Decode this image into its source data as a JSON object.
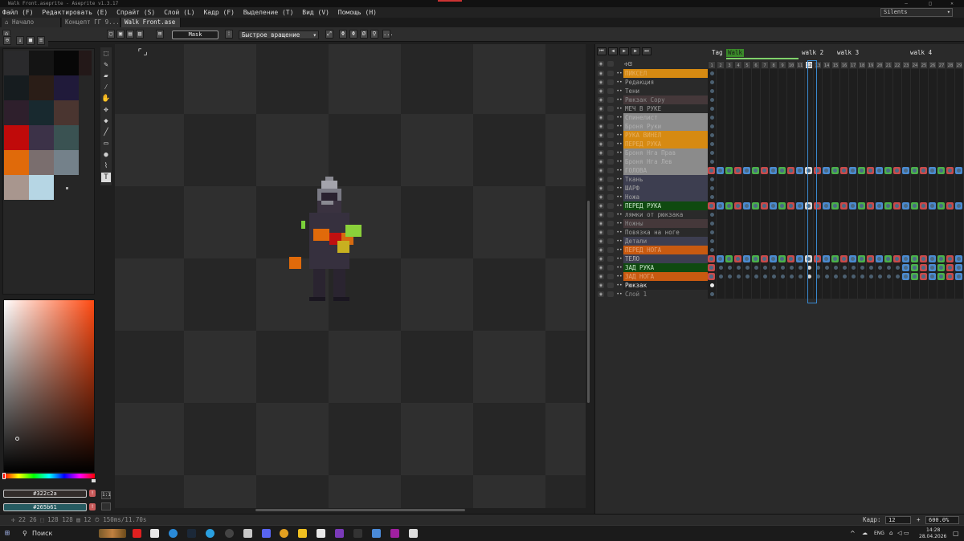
{
  "window": {
    "title": "Walk Front.aseprite - Aseprite v1.3.17",
    "minimize": "—",
    "maximize": "□",
    "close": "✕"
  },
  "menu": [
    {
      "label": "Файл (F)"
    },
    {
      "label": "Редактировать (E)"
    },
    {
      "label": "Спрайт (S)"
    },
    {
      "label": "Слой (L)"
    },
    {
      "label": "Кадр (F)"
    },
    {
      "label": "Выделение (T)"
    },
    {
      "label": "Вид (V)"
    },
    {
      "label": "Помощь (H)"
    }
  ],
  "theme_select": "Silents",
  "tabs": [
    {
      "label": "Начало"
    },
    {
      "label": "Концепт ГГ 9..."
    },
    {
      "label": "Walk Front.ase ●"
    }
  ],
  "toolbar": {
    "mask_label": "Mask",
    "rotation_label": "Быстрое вращение",
    "more_label": "..."
  },
  "palette": {
    "colors": [
      "#2a2a2c",
      "#141414",
      "#070707",
      "#231818",
      "#161c1f",
      "#2a1d17",
      "#201a3a",
      "#2e1f2c",
      "#18292f",
      "#4a3530",
      "#c00a0a",
      "#3c3248",
      "#3a5252",
      "#e06a0a",
      "#7a6e6e",
      "#74818a",
      "#a8968e",
      "#b6d6e4"
    ],
    "fg_hex": "#322c2a",
    "bg_hex": "#265b61",
    "accent": "#ff4a12"
  },
  "tools": [
    "selection-icon",
    "pencil-icon",
    "eraser-icon",
    "eyedropper-icon",
    "hand-icon",
    "move-icon",
    "fill-icon",
    "line-icon",
    "rectangle-icon",
    "blur-icon",
    "contour-icon",
    "text-icon"
  ],
  "side_buttons": {
    "one_to_one": "1:1"
  },
  "status": {
    "text": "✢ 22 26  ⬚ 128 128  ▤ 12  ⏱ 150ms/11.70s",
    "frame_label": "Кадр:",
    "frame_value": "12",
    "zoom_plus": "+",
    "zoom_value": "600.0%"
  },
  "timeline": {
    "buttons": [
      "⏮",
      "◀",
      "▶",
      "▶",
      "⏭"
    ],
    "tags": [
      {
        "name": "Tag"
      },
      {
        "name": "Walk"
      },
      {
        "name": "walk 2"
      },
      {
        "name": "walk 3"
      },
      {
        "name": "walk 4"
      }
    ],
    "frames": [
      "1",
      "2",
      "3",
      "4",
      "5",
      "6",
      "7",
      "8",
      "9",
      "10",
      "11",
      "12",
      "13",
      "14",
      "15",
      "16",
      "17",
      "18",
      "19",
      "20",
      "21",
      "22",
      "23",
      "24",
      "25",
      "26",
      "27",
      "28",
      "29"
    ],
    "current_frame": "12",
    "layers": [
      {
        "name": "ПИКСЕЛ",
        "color": "#d68a12",
        "text": "#e8b060"
      },
      {
        "name": "Редакция",
        "color": "#2a2a2a",
        "text": "#9e9e9e"
      },
      {
        "name": "Тени",
        "color": "#2a2a2a",
        "text": "#9e9e9e"
      },
      {
        "name": "Рюкзак Copy",
        "color": "#45383a",
        "text": "#8a8a8a"
      },
      {
        "name": "МЕЧ В РУКЕ",
        "color": "#2a2a2a",
        "text": "#9e9e9e"
      },
      {
        "name": "Спинелист",
        "color": "#8b8b8b",
        "text": "#b0b0b0"
      },
      {
        "name": "Броня Руки",
        "color": "#8b8b8b",
        "text": "#b0b0b0"
      },
      {
        "name": "РУКА ВИНЕЛ",
        "color": "#d68a12",
        "text": "#e8b060"
      },
      {
        "name": "ПЕРЕД РУКА",
        "color": "#d68a12",
        "text": "#e8b060"
      },
      {
        "name": "Броня Нга Прав",
        "color": "#8b8b8b",
        "text": "#b0b0b0"
      },
      {
        "name": "Броня Нга Лев",
        "color": "#8b8b8b",
        "text": "#b0b0b0"
      },
      {
        "name": "ГОЛОВА",
        "color": "#8b8b8b",
        "text": "#b0b0b0"
      },
      {
        "name": "Ткань",
        "color": "#3d3e50",
        "text": "#9e9e9e"
      },
      {
        "name": "ШАРФ",
        "color": "#3d3e50",
        "text": "#9e9e9e"
      },
      {
        "name": "Ножа",
        "color": "#3d3e50",
        "text": "#9e9e9e"
      },
      {
        "name": "ПЕРЕД РУКА",
        "color": "#0f4a10",
        "text": "#c8e6c8"
      },
      {
        "name": "лямки от рюкзака",
        "color": "#2a2a2a",
        "text": "#9e9e9e"
      },
      {
        "name": "Ножны",
        "color": "#45383a",
        "text": "#8a8a8a"
      },
      {
        "name": "Повязка на ноге",
        "color": "#2a2a2a",
        "text": "#9e9e9e"
      },
      {
        "name": "Детали",
        "color": "#3d3e50",
        "text": "#9e9e9e"
      },
      {
        "name": "ПЕРЕД НОГА",
        "color": "#c85a10",
        "text": "#e6a070"
      },
      {
        "name": "ТЕЛО",
        "color": "#3d3e50",
        "text": "#b6b6b6"
      },
      {
        "name": "ЗАД РУКА",
        "color": "#0f4a10",
        "text": "#c8e6c8"
      },
      {
        "name": "ЗАД НОГА",
        "color": "#c85a10",
        "text": "#e6a070"
      },
      {
        "name": "Рюкзак",
        "color": "#222",
        "text": "#e6e6e6"
      },
      {
        "name": "Слой 1",
        "color": "#2a2a2a",
        "text": "#8a8a8a"
      }
    ]
  },
  "taskbar": {
    "search_label": "Поиск",
    "lang": "ENG",
    "time": "14:28",
    "date": "28.04.2026"
  }
}
